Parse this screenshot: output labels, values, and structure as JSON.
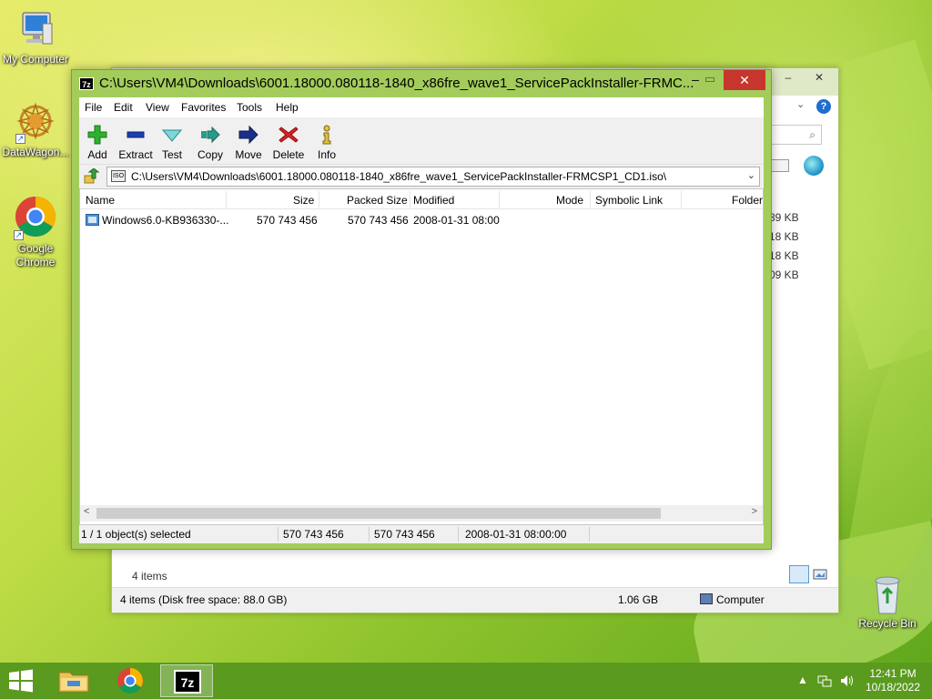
{
  "desktop": {
    "icons": [
      {
        "label": "My Computer"
      },
      {
        "label": "DataWagon..."
      },
      {
        "label": "Google Chrome"
      },
      {
        "label": "Recycle Bin"
      }
    ]
  },
  "explorer": {
    "sizes": [
      "39 KB",
      "18 KB",
      "18 KB",
      "09 KB"
    ],
    "item_count": "4 items",
    "status": {
      "summary": "4 items (Disk free space: 88.0 GB)",
      "size": "1.06 GB",
      "location": "Computer"
    }
  },
  "sevenzip": {
    "title": "C:\\Users\\VM4\\Downloads\\6001.18000.080118-1840_x86fre_wave1_ServicePackInstaller-FRMC...",
    "menu": [
      "File",
      "Edit",
      "View",
      "Favorites",
      "Tools",
      "Help"
    ],
    "toolbar": {
      "add": "Add",
      "extract": "Extract",
      "test": "Test",
      "copy": "Copy",
      "move": "Move",
      "delete": "Delete",
      "info": "Info"
    },
    "address": "C:\\Users\\VM4\\Downloads\\6001.18000.080118-1840_x86fre_wave1_ServicePackInstaller-FRMCSP1_CD1.iso\\",
    "columns": {
      "name": "Name",
      "size": "Size",
      "packed": "Packed Size",
      "modified": "Modified",
      "mode": "Mode",
      "symlink": "Symbolic Link",
      "folder": "Folder"
    },
    "rows": [
      {
        "name": "Windows6.0-KB936330-...",
        "size": "570 743 456",
        "packed": "570 743 456",
        "modified": "2008-01-31 08:00"
      }
    ],
    "status": {
      "selected": "1 / 1 object(s) selected",
      "size": "570 743 456",
      "packed": "570 743 456",
      "modified": "2008-01-31 08:00:00"
    }
  },
  "taskbar": {
    "clock_time": "12:41 PM",
    "clock_date": "10/18/2022",
    "items": [
      "File Explorer",
      "Google Chrome",
      "7-Zip"
    ]
  },
  "colors": {
    "window_frame": "#a3cc5a",
    "close_button": "#c7362e",
    "taskbar": "#5a9a1e"
  }
}
